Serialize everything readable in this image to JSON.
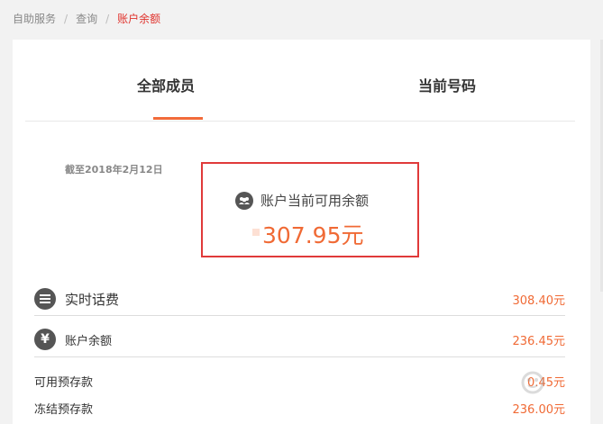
{
  "breadcrumb": {
    "items": [
      "自助服务",
      "查询"
    ],
    "current": "账户余额",
    "separator": "/"
  },
  "tabs": {
    "all_members": "全部成员",
    "current_number": "当前号码"
  },
  "as_of": "截至2018年2月12日",
  "balance": {
    "label": "账户当前可用余额",
    "amount": "307.95元"
  },
  "rows": [
    {
      "label": "实时话费",
      "value": "308.40元",
      "icon": "list-icon"
    },
    {
      "label": "账户余额",
      "value": "236.45元",
      "icon": "yen-icon"
    },
    {
      "label": "可用预存款",
      "value": "0.45元"
    },
    {
      "label": "冻结预存款",
      "value": "236.00元"
    }
  ],
  "colors": {
    "accent": "#f06a35",
    "highlight_border": "#e03a3a",
    "breadcrumb_current": "#e0322c"
  }
}
